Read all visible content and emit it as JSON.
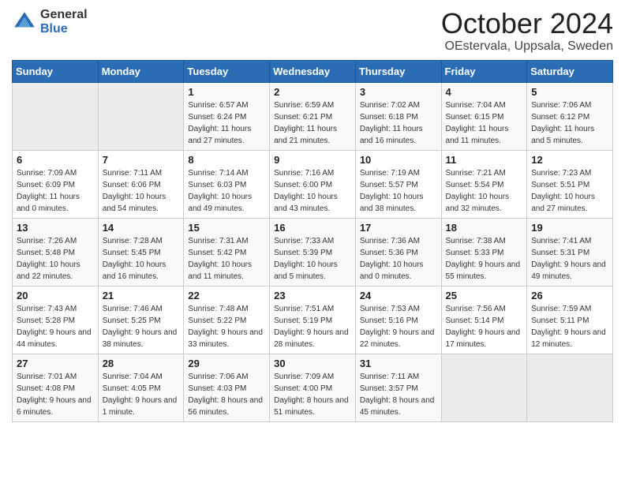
{
  "header": {
    "logo_general": "General",
    "logo_blue": "Blue",
    "month_title": "October 2024",
    "subtitle": "OEstervala, Uppsala, Sweden"
  },
  "weekdays": [
    "Sunday",
    "Monday",
    "Tuesday",
    "Wednesday",
    "Thursday",
    "Friday",
    "Saturday"
  ],
  "weeks": [
    [
      {
        "day": "",
        "sunrise": "",
        "sunset": "",
        "daylight": ""
      },
      {
        "day": "",
        "sunrise": "",
        "sunset": "",
        "daylight": ""
      },
      {
        "day": "1",
        "sunrise": "Sunrise: 6:57 AM",
        "sunset": "Sunset: 6:24 PM",
        "daylight": "Daylight: 11 hours and 27 minutes."
      },
      {
        "day": "2",
        "sunrise": "Sunrise: 6:59 AM",
        "sunset": "Sunset: 6:21 PM",
        "daylight": "Daylight: 11 hours and 21 minutes."
      },
      {
        "day": "3",
        "sunrise": "Sunrise: 7:02 AM",
        "sunset": "Sunset: 6:18 PM",
        "daylight": "Daylight: 11 hours and 16 minutes."
      },
      {
        "day": "4",
        "sunrise": "Sunrise: 7:04 AM",
        "sunset": "Sunset: 6:15 PM",
        "daylight": "Daylight: 11 hours and 11 minutes."
      },
      {
        "day": "5",
        "sunrise": "Sunrise: 7:06 AM",
        "sunset": "Sunset: 6:12 PM",
        "daylight": "Daylight: 11 hours and 5 minutes."
      }
    ],
    [
      {
        "day": "6",
        "sunrise": "Sunrise: 7:09 AM",
        "sunset": "Sunset: 6:09 PM",
        "daylight": "Daylight: 11 hours and 0 minutes."
      },
      {
        "day": "7",
        "sunrise": "Sunrise: 7:11 AM",
        "sunset": "Sunset: 6:06 PM",
        "daylight": "Daylight: 10 hours and 54 minutes."
      },
      {
        "day": "8",
        "sunrise": "Sunrise: 7:14 AM",
        "sunset": "Sunset: 6:03 PM",
        "daylight": "Daylight: 10 hours and 49 minutes."
      },
      {
        "day": "9",
        "sunrise": "Sunrise: 7:16 AM",
        "sunset": "Sunset: 6:00 PM",
        "daylight": "Daylight: 10 hours and 43 minutes."
      },
      {
        "day": "10",
        "sunrise": "Sunrise: 7:19 AM",
        "sunset": "Sunset: 5:57 PM",
        "daylight": "Daylight: 10 hours and 38 minutes."
      },
      {
        "day": "11",
        "sunrise": "Sunrise: 7:21 AM",
        "sunset": "Sunset: 5:54 PM",
        "daylight": "Daylight: 10 hours and 32 minutes."
      },
      {
        "day": "12",
        "sunrise": "Sunrise: 7:23 AM",
        "sunset": "Sunset: 5:51 PM",
        "daylight": "Daylight: 10 hours and 27 minutes."
      }
    ],
    [
      {
        "day": "13",
        "sunrise": "Sunrise: 7:26 AM",
        "sunset": "Sunset: 5:48 PM",
        "daylight": "Daylight: 10 hours and 22 minutes."
      },
      {
        "day": "14",
        "sunrise": "Sunrise: 7:28 AM",
        "sunset": "Sunset: 5:45 PM",
        "daylight": "Daylight: 10 hours and 16 minutes."
      },
      {
        "day": "15",
        "sunrise": "Sunrise: 7:31 AM",
        "sunset": "Sunset: 5:42 PM",
        "daylight": "Daylight: 10 hours and 11 minutes."
      },
      {
        "day": "16",
        "sunrise": "Sunrise: 7:33 AM",
        "sunset": "Sunset: 5:39 PM",
        "daylight": "Daylight: 10 hours and 5 minutes."
      },
      {
        "day": "17",
        "sunrise": "Sunrise: 7:36 AM",
        "sunset": "Sunset: 5:36 PM",
        "daylight": "Daylight: 10 hours and 0 minutes."
      },
      {
        "day": "18",
        "sunrise": "Sunrise: 7:38 AM",
        "sunset": "Sunset: 5:33 PM",
        "daylight": "Daylight: 9 hours and 55 minutes."
      },
      {
        "day": "19",
        "sunrise": "Sunrise: 7:41 AM",
        "sunset": "Sunset: 5:31 PM",
        "daylight": "Daylight: 9 hours and 49 minutes."
      }
    ],
    [
      {
        "day": "20",
        "sunrise": "Sunrise: 7:43 AM",
        "sunset": "Sunset: 5:28 PM",
        "daylight": "Daylight: 9 hours and 44 minutes."
      },
      {
        "day": "21",
        "sunrise": "Sunrise: 7:46 AM",
        "sunset": "Sunset: 5:25 PM",
        "daylight": "Daylight: 9 hours and 38 minutes."
      },
      {
        "day": "22",
        "sunrise": "Sunrise: 7:48 AM",
        "sunset": "Sunset: 5:22 PM",
        "daylight": "Daylight: 9 hours and 33 minutes."
      },
      {
        "day": "23",
        "sunrise": "Sunrise: 7:51 AM",
        "sunset": "Sunset: 5:19 PM",
        "daylight": "Daylight: 9 hours and 28 minutes."
      },
      {
        "day": "24",
        "sunrise": "Sunrise: 7:53 AM",
        "sunset": "Sunset: 5:16 PM",
        "daylight": "Daylight: 9 hours and 22 minutes."
      },
      {
        "day": "25",
        "sunrise": "Sunrise: 7:56 AM",
        "sunset": "Sunset: 5:14 PM",
        "daylight": "Daylight: 9 hours and 17 minutes."
      },
      {
        "day": "26",
        "sunrise": "Sunrise: 7:59 AM",
        "sunset": "Sunset: 5:11 PM",
        "daylight": "Daylight: 9 hours and 12 minutes."
      }
    ],
    [
      {
        "day": "27",
        "sunrise": "Sunrise: 7:01 AM",
        "sunset": "Sunset: 4:08 PM",
        "daylight": "Daylight: 9 hours and 6 minutes."
      },
      {
        "day": "28",
        "sunrise": "Sunrise: 7:04 AM",
        "sunset": "Sunset: 4:05 PM",
        "daylight": "Daylight: 9 hours and 1 minute."
      },
      {
        "day": "29",
        "sunrise": "Sunrise: 7:06 AM",
        "sunset": "Sunset: 4:03 PM",
        "daylight": "Daylight: 8 hours and 56 minutes."
      },
      {
        "day": "30",
        "sunrise": "Sunrise: 7:09 AM",
        "sunset": "Sunset: 4:00 PM",
        "daylight": "Daylight: 8 hours and 51 minutes."
      },
      {
        "day": "31",
        "sunrise": "Sunrise: 7:11 AM",
        "sunset": "Sunset: 3:57 PM",
        "daylight": "Daylight: 8 hours and 45 minutes."
      },
      {
        "day": "",
        "sunrise": "",
        "sunset": "",
        "daylight": ""
      },
      {
        "day": "",
        "sunrise": "",
        "sunset": "",
        "daylight": ""
      }
    ]
  ]
}
